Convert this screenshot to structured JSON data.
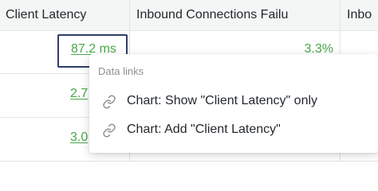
{
  "table": {
    "headers": [
      "Client Latency",
      "Inbound Connections Failu",
      "Inbo"
    ],
    "rows": [
      {
        "latency": "87.2 ms",
        "failures": "3.3%"
      },
      {
        "latency": "2.7"
      },
      {
        "latency": "3.0"
      }
    ]
  },
  "context_menu": {
    "header": "Data links",
    "items": [
      {
        "label": "Chart: Show \"Client Latency\" only",
        "icon": "link-icon"
      },
      {
        "label": "Chart: Add \"Client Latency\"",
        "icon": "link-icon"
      }
    ]
  },
  "colors": {
    "link_green": "#4aa64a",
    "focus_outline": "#2f3d6b",
    "header_bg": "#f4f5f5",
    "text": "#24292e",
    "muted": "#8e9196"
  }
}
